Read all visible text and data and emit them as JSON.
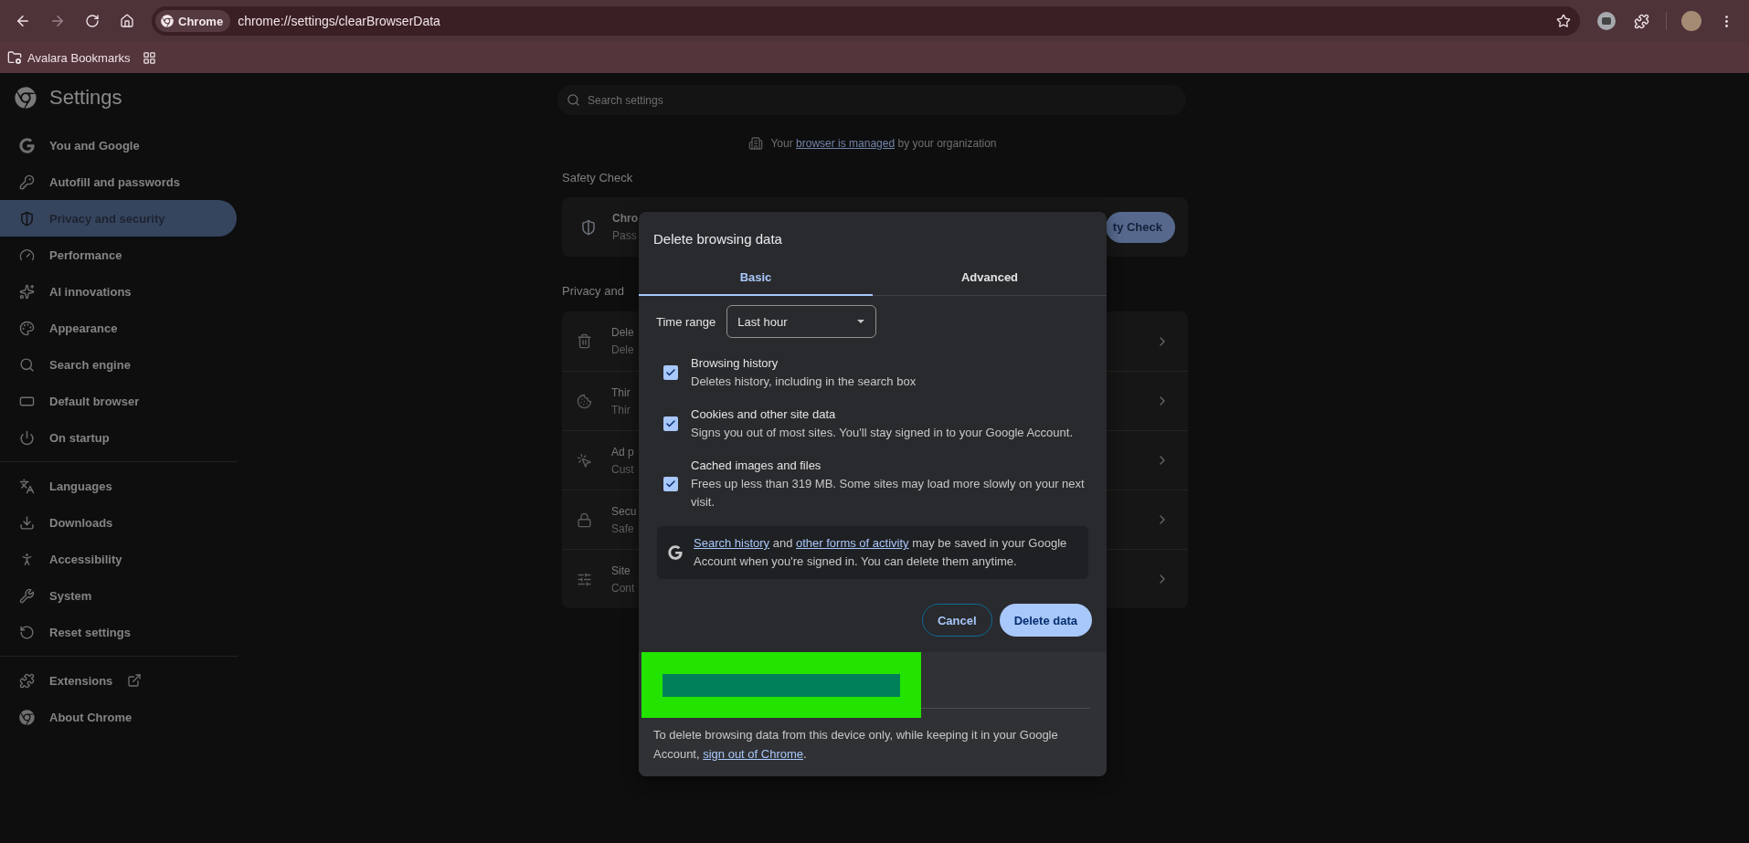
{
  "browser": {
    "omnibox": {
      "chip": "Chrome",
      "url": "chrome://settings/clearBrowserData",
      "starred": false
    },
    "bookmarks": [
      {
        "label": "Avalara Bookmarks"
      }
    ]
  },
  "sidebar": {
    "title": "Settings",
    "groups": [
      [
        {
          "label": "You and Google",
          "selected": false,
          "external": false
        },
        {
          "label": "Autofill and passwords",
          "selected": false,
          "external": false
        },
        {
          "label": "Privacy and security",
          "selected": true,
          "external": false
        },
        {
          "label": "Performance",
          "selected": false,
          "external": false
        },
        {
          "label": "AI innovations",
          "selected": false,
          "external": false
        },
        {
          "label": "Appearance",
          "selected": false,
          "external": false
        },
        {
          "label": "Search engine",
          "selected": false,
          "external": false
        },
        {
          "label": "Default browser",
          "selected": false,
          "external": false
        },
        {
          "label": "On startup",
          "selected": false,
          "external": false
        }
      ],
      [
        {
          "label": "Languages",
          "selected": false,
          "external": false
        },
        {
          "label": "Downloads",
          "selected": false,
          "external": false
        },
        {
          "label": "Accessibility",
          "selected": false,
          "external": false
        },
        {
          "label": "System",
          "selected": false,
          "external": false
        },
        {
          "label": "Reset settings",
          "selected": false,
          "external": false
        }
      ],
      [
        {
          "label": "Extensions",
          "selected": false,
          "external": true
        },
        {
          "label": "About Chrome",
          "selected": false,
          "external": false
        }
      ]
    ]
  },
  "main": {
    "search": {
      "placeholder": "Search settings"
    },
    "managed_notice": [
      {
        "text": "Your",
        "link": false
      },
      {
        "text": "browser is managed",
        "link": true
      },
      {
        "text": "by your organization",
        "link": false
      }
    ],
    "safety_check": {
      "heading": "Safety Check",
      "title": "Chro",
      "subtitle": "Pass",
      "button": "ty Check"
    },
    "privacy": {
      "heading": "Privacy and",
      "rows": [
        {
          "title": "Dele",
          "subtitle": "Dele"
        },
        {
          "title": "Thir",
          "subtitle": "Thir"
        },
        {
          "title": "Ad p",
          "subtitle": "Cust"
        },
        {
          "title": "Secu",
          "subtitle": "Safe"
        },
        {
          "title": "Site",
          "subtitle": "Cont"
        }
      ]
    }
  },
  "dialog": {
    "title": "Delete browsing data",
    "tabs": [
      {
        "label": "Basic",
        "selected": true
      },
      {
        "label": "Advanced",
        "selected": false
      }
    ],
    "time_range": {
      "label": "Time range",
      "value": "Last hour"
    },
    "options": [
      {
        "title": "Browsing history",
        "description": "Deletes history, including in the search box",
        "checked": true
      },
      {
        "title": "Cookies and other site data",
        "description": "Signs you out of most sites. You'll stay signed in to your Google Account.",
        "checked": true
      },
      {
        "title": "Cached images and files",
        "description": "Frees up less than 319 MB. Some sites may load more slowly on your next visit.",
        "checked": true
      }
    ],
    "notice": [
      {
        "text": "Search history",
        "link": true
      },
      {
        "text": " and ",
        "link": false
      },
      {
        "text": "other forms of activity",
        "link": true
      },
      {
        "text": " may be saved in your Google Account when you're signed in. You can delete them anytime.",
        "link": false
      }
    ],
    "buttons": [
      {
        "label": "Cancel",
        "kind": "outlined"
      },
      {
        "label": "Delete data",
        "kind": "filled"
      }
    ],
    "redacted": true,
    "footer": [
      {
        "text": "To delete browsing data from this device only, while keeping it in your Google Account, ",
        "link": false
      },
      {
        "text": "sign out of Chrome",
        "link": true
      },
      {
        "text": ".",
        "link": false
      }
    ]
  }
}
